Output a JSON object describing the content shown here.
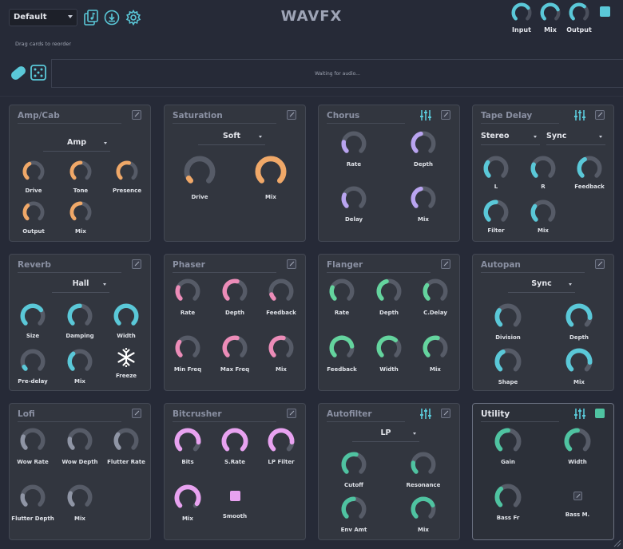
{
  "header": {
    "preset": "Default",
    "title": "WAVFX",
    "hint": "Drag cards to reorder",
    "knobs": [
      {
        "label": "Input",
        "value": 0.7
      },
      {
        "label": "Mix",
        "value": 0.75
      },
      {
        "label": "Output",
        "value": 0.65
      }
    ]
  },
  "status": {
    "waiting": "Waiting for audio..."
  },
  "colors": {
    "cyan": "#5ac8d8",
    "orange": "#f0a868",
    "purple": "#b9a4f0",
    "pink": "#ec8cb8",
    "green": "#64d49e",
    "gray": "#8f95a5",
    "magenta": "#e8a2f0",
    "teal": "#4fc3a1"
  },
  "cards": [
    {
      "name": "amp-cab",
      "title": "Amp/Cab",
      "eq": false,
      "active": false,
      "dropdowns": [
        "Amp"
      ],
      "knobs": [
        {
          "label": "Drive",
          "value": 0.4
        },
        {
          "label": "Tone",
          "value": 0.5
        },
        {
          "label": "Presence",
          "value": 0.55
        },
        {
          "label": "Output",
          "value": 0.35
        },
        {
          "label": "Mix",
          "value": 0.5
        }
      ]
    },
    {
      "name": "saturation",
      "title": "Saturation",
      "eq": false,
      "active": false,
      "dropdowns": [
        "Soft"
      ],
      "knobs": [
        {
          "label": "Drive",
          "value": 0.05
        },
        {
          "label": "Mix",
          "value": 1.0
        }
      ]
    },
    {
      "name": "chorus",
      "title": "Chorus",
      "eq": true,
      "active": false,
      "dropdowns": [],
      "knobs": [
        {
          "label": "Rate",
          "value": 0.2
        },
        {
          "label": "Depth",
          "value": 0.45
        },
        {
          "label": "Delay",
          "value": 0.25
        },
        {
          "label": "Mix",
          "value": 0.45
        }
      ]
    },
    {
      "name": "tape-delay",
      "title": "Tape Delay",
      "eq": true,
      "active": false,
      "dropdowns": [
        "Stereo",
        "Sync"
      ],
      "knobs": [
        {
          "label": "L",
          "value": 0.3
        },
        {
          "label": "R",
          "value": 0.25
        },
        {
          "label": "Feedback",
          "value": 0.4
        },
        {
          "label": "Filter",
          "value": 0.5
        },
        {
          "label": "Mix",
          "value": 0.3
        }
      ]
    },
    {
      "name": "reverb",
      "title": "Reverb",
      "eq": false,
      "active": false,
      "dropdowns": [
        "Hall"
      ],
      "knobs": [
        {
          "label": "Size",
          "value": 0.7
        },
        {
          "label": "Damping",
          "value": 0.5
        },
        {
          "label": "Width",
          "value": 1.0
        },
        {
          "label": "Pre-delay",
          "value": 0.05
        },
        {
          "label": "Mix",
          "value": 0.35
        }
      ],
      "freeze": "Freeze"
    },
    {
      "name": "phaser",
      "title": "Phaser",
      "eq": false,
      "active": false,
      "dropdowns": [],
      "knobs": [
        {
          "label": "Rate",
          "value": 0.25
        },
        {
          "label": "Depth",
          "value": 0.55
        },
        {
          "label": "Feedback",
          "value": 0.1
        },
        {
          "label": "Min Freq",
          "value": 0.3
        },
        {
          "label": "Max Freq",
          "value": 0.55
        },
        {
          "label": "Mix",
          "value": 0.55
        }
      ]
    },
    {
      "name": "flanger",
      "title": "Flanger",
      "eq": false,
      "active": false,
      "dropdowns": [],
      "knobs": [
        {
          "label": "Rate",
          "value": 0.25
        },
        {
          "label": "Depth",
          "value": 0.45
        },
        {
          "label": "C.Delay",
          "value": 0.3
        },
        {
          "label": "Feedback",
          "value": 0.8
        },
        {
          "label": "Width",
          "value": 0.65
        },
        {
          "label": "Mix",
          "value": 0.55
        }
      ]
    },
    {
      "name": "autopan",
      "title": "Autopan",
      "eq": false,
      "active": false,
      "dropdowns": [
        "Sync"
      ],
      "knobs": [
        {
          "label": "Division",
          "value": 0.3
        },
        {
          "label": "Depth",
          "value": 0.85
        },
        {
          "label": "Shape",
          "value": 0.4
        },
        {
          "label": "Mix",
          "value": 0.85
        }
      ]
    },
    {
      "name": "lofi",
      "title": "Lofi",
      "eq": false,
      "active": false,
      "dropdowns": [],
      "knobs": [
        {
          "label": "Wow Rate",
          "value": 0.25
        },
        {
          "label": "Wow Depth",
          "value": 0.2
        },
        {
          "label": "Flutter Rate",
          "value": 0.3
        },
        {
          "label": "Flutter Depth",
          "value": 0.2
        },
        {
          "label": "Mix",
          "value": 0.25
        }
      ]
    },
    {
      "name": "bitcrusher",
      "title": "Bitcrusher",
      "eq": false,
      "active": false,
      "dropdowns": [],
      "knobs": [
        {
          "label": "Bits",
          "value": 0.85
        },
        {
          "label": "S.Rate",
          "value": 1.0
        },
        {
          "label": "LP Filter",
          "value": 0.85
        },
        {
          "label": "Mix",
          "value": 0.95
        }
      ],
      "smooth": "Smooth"
    },
    {
      "name": "autofilter",
      "title": "Autofilter",
      "eq": true,
      "active": false,
      "dropdowns": [
        "LP"
      ],
      "knobs": [
        {
          "label": "Cutoff",
          "value": 0.55
        },
        {
          "label": "Resonance",
          "value": 0.2
        },
        {
          "label": "Env Amt",
          "value": 0.5
        },
        {
          "label": "Mix",
          "value": 0.75
        }
      ]
    },
    {
      "name": "utility",
      "title": "Utility",
      "eq": true,
      "active": true,
      "dropdowns": [],
      "knobs": [
        {
          "label": "Gain",
          "value": 0.5
        },
        {
          "label": "Width",
          "value": 0.5
        },
        {
          "label": "Bass Fr",
          "value": 0.35
        }
      ],
      "bassmono": "Bass M."
    }
  ]
}
